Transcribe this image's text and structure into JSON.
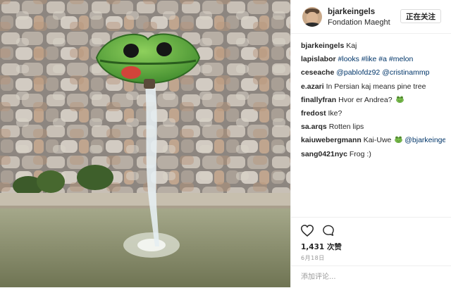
{
  "post": {
    "photo_alt": "Green frog-mouth fountain spout on a stone wall",
    "icon_frog": "frog-emoji-icon"
  },
  "header": {
    "username": "bjarkeingels",
    "location": "Fondation Maeght",
    "follow_label": "正在关注"
  },
  "comments": [
    {
      "user": "bjarkeingels",
      "parts": [
        {
          "t": "Kaj",
          "link": false
        }
      ]
    },
    {
      "user": "lapislabor",
      "parts": [
        {
          "t": "#looks #like #a #melon",
          "link": true
        }
      ]
    },
    {
      "user": "ceseache",
      "parts": [
        {
          "t": "@pablofdz92",
          "link": true
        },
        {
          "t": " ",
          "link": false
        },
        {
          "t": "@cristinammp",
          "link": true
        }
      ]
    },
    {
      "user": "e.azari",
      "parts": [
        {
          "t": "In Persian kaj means pine tree",
          "link": false
        }
      ]
    },
    {
      "user": "finallyfran",
      "parts": [
        {
          "t": "Hvor er Andrea?",
          "link": false
        }
      ],
      "emoji": true
    },
    {
      "user": "fredost",
      "parts": [
        {
          "t": "Ike?",
          "link": false
        }
      ]
    },
    {
      "user": "sa.arqs",
      "parts": [
        {
          "t": "Rotten lips",
          "link": false
        }
      ]
    },
    {
      "user": "kaiuwebergmann",
      "parts": [
        {
          "t": "Kai-Uwe",
          "link": false
        }
      ],
      "emoji": true,
      "after": [
        {
          "t": "@bjarkeingels",
          "link": true
        }
      ]
    },
    {
      "user": "sang0421nyc",
      "parts": [
        {
          "t": "Frog :)",
          "link": false
        }
      ]
    }
  ],
  "actions": {
    "like_icon": "heart-icon",
    "comment_icon": "comment-bubble-icon"
  },
  "likes_text": "1,431 次赞",
  "date_text": "6月18日",
  "add_comment_placeholder": "添加评论..."
}
